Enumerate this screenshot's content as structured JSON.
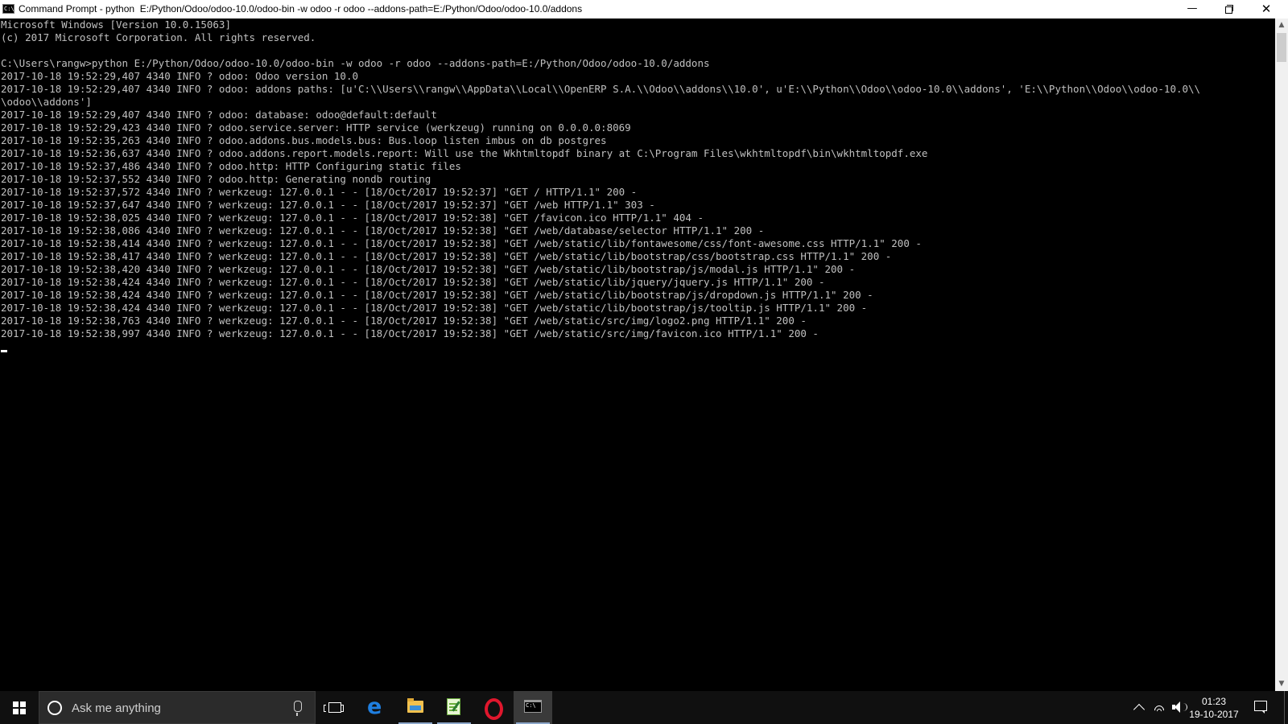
{
  "window": {
    "title": "Command Prompt - python  E:/Python/Odoo/odoo-10.0/odoo-bin -w odoo -r odoo --addons-path=E:/Python/Odoo/odoo-10.0/addons",
    "icon_text": "C:\\",
    "minimize_glyph": "—",
    "close_glyph": "✕"
  },
  "console": {
    "lines": [
      "Microsoft Windows [Version 10.0.15063]",
      "(c) 2017 Microsoft Corporation. All rights reserved.",
      "",
      "C:\\Users\\rangw>python E:/Python/Odoo/odoo-10.0/odoo-bin -w odoo -r odoo --addons-path=E:/Python/Odoo/odoo-10.0/addons",
      "2017-10-18 19:52:29,407 4340 INFO ? odoo: Odoo version 10.0",
      "2017-10-18 19:52:29,407 4340 INFO ? odoo: addons paths: [u'C:\\\\Users\\\\rangw\\\\AppData\\\\Local\\\\OpenERP S.A.\\\\Odoo\\\\addons\\\\10.0', u'E:\\\\Python\\\\Odoo\\\\odoo-10.0\\\\addons', 'E:\\\\Python\\\\Odoo\\\\odoo-10.0\\\\",
      "\\odoo\\\\addons']",
      "2017-10-18 19:52:29,407 4340 INFO ? odoo: database: odoo@default:default",
      "2017-10-18 19:52:29,423 4340 INFO ? odoo.service.server: HTTP service (werkzeug) running on 0.0.0.0:8069",
      "2017-10-18 19:52:35,263 4340 INFO ? odoo.addons.bus.models.bus: Bus.loop listen imbus on db postgres",
      "2017-10-18 19:52:36,637 4340 INFO ? odoo.addons.report.models.report: Will use the Wkhtmltopdf binary at C:\\Program Files\\wkhtmltopdf\\bin\\wkhtmltopdf.exe",
      "2017-10-18 19:52:37,486 4340 INFO ? odoo.http: HTTP Configuring static files",
      "2017-10-18 19:52:37,552 4340 INFO ? odoo.http: Generating nondb routing",
      "2017-10-18 19:52:37,572 4340 INFO ? werkzeug: 127.0.0.1 - - [18/Oct/2017 19:52:37] \"GET / HTTP/1.1\" 200 -",
      "2017-10-18 19:52:37,647 4340 INFO ? werkzeug: 127.0.0.1 - - [18/Oct/2017 19:52:37] \"GET /web HTTP/1.1\" 303 -",
      "2017-10-18 19:52:38,025 4340 INFO ? werkzeug: 127.0.0.1 - - [18/Oct/2017 19:52:38] \"GET /favicon.ico HTTP/1.1\" 404 -",
      "2017-10-18 19:52:38,086 4340 INFO ? werkzeug: 127.0.0.1 - - [18/Oct/2017 19:52:38] \"GET /web/database/selector HTTP/1.1\" 200 -",
      "2017-10-18 19:52:38,414 4340 INFO ? werkzeug: 127.0.0.1 - - [18/Oct/2017 19:52:38] \"GET /web/static/lib/fontawesome/css/font-awesome.css HTTP/1.1\" 200 -",
      "2017-10-18 19:52:38,417 4340 INFO ? werkzeug: 127.0.0.1 - - [18/Oct/2017 19:52:38] \"GET /web/static/lib/bootstrap/css/bootstrap.css HTTP/1.1\" 200 -",
      "2017-10-18 19:52:38,420 4340 INFO ? werkzeug: 127.0.0.1 - - [18/Oct/2017 19:52:38] \"GET /web/static/lib/bootstrap/js/modal.js HTTP/1.1\" 200 -",
      "2017-10-18 19:52:38,424 4340 INFO ? werkzeug: 127.0.0.1 - - [18/Oct/2017 19:52:38] \"GET /web/static/lib/jquery/jquery.js HTTP/1.1\" 200 -",
      "2017-10-18 19:52:38,424 4340 INFO ? werkzeug: 127.0.0.1 - - [18/Oct/2017 19:52:38] \"GET /web/static/lib/bootstrap/js/dropdown.js HTTP/1.1\" 200 -",
      "2017-10-18 19:52:38,424 4340 INFO ? werkzeug: 127.0.0.1 - - [18/Oct/2017 19:52:38] \"GET /web/static/lib/bootstrap/js/tooltip.js HTTP/1.1\" 200 -",
      "2017-10-18 19:52:38,763 4340 INFO ? werkzeug: 127.0.0.1 - - [18/Oct/2017 19:52:38] \"GET /web/static/src/img/logo2.png HTTP/1.1\" 200 -",
      "2017-10-18 19:52:38,997 4340 INFO ? werkzeug: 127.0.0.1 - - [18/Oct/2017 19:52:38] \"GET /web/static/src/img/favicon.ico HTTP/1.1\" 200 -",
      ""
    ]
  },
  "taskbar": {
    "search_placeholder": "Ask me anything",
    "apps": [
      {
        "name": "edge",
        "icon": "edge-icon"
      },
      {
        "name": "file-explorer",
        "icon": "folder-icon"
      },
      {
        "name": "notepad",
        "icon": "notepad-icon"
      },
      {
        "name": "opera",
        "icon": "opera-icon"
      },
      {
        "name": "command-prompt",
        "icon": "terminal-icon"
      }
    ],
    "edge_glyph": "e",
    "clock": {
      "time": "01:23",
      "date": "19-10-2017"
    }
  },
  "colors": {
    "console_bg": "#000000",
    "console_fg": "#c0c0c0",
    "taskbar_bg": "#101010",
    "accent": "#8ca6c9"
  }
}
